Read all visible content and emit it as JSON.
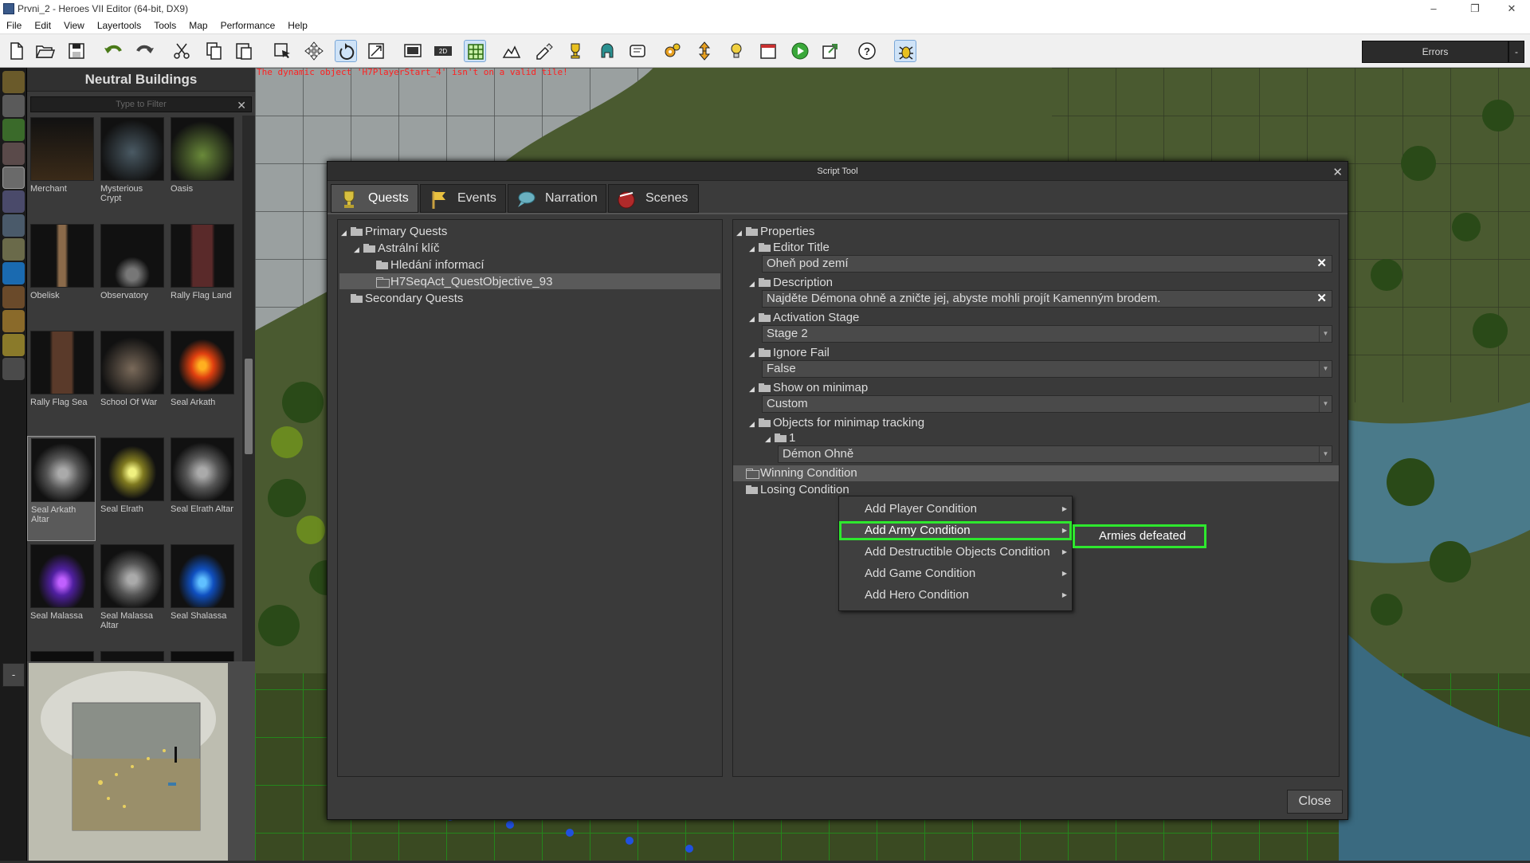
{
  "window": {
    "title": "Prvni_2 - Heroes VII Editor (64-bit, DX9)",
    "controls": [
      "–",
      "❐",
      "✕"
    ]
  },
  "menu": [
    "File",
    "Edit",
    "View",
    "Layertools",
    "Tools",
    "Map",
    "Performance",
    "Help"
  ],
  "toolbar": {
    "icons": [
      "new-file-icon",
      "open-folder-icon",
      "save-icon",
      "undo-icon",
      "redo-icon",
      "cut-icon",
      "copy-icon",
      "paste-icon",
      "select-icon",
      "move-icon",
      "rotate-icon",
      "scale-icon",
      "viewport-icon",
      "2d-view-icon",
      "grid-icon",
      "terrain-icon",
      "paint-icon",
      "trophy-icon",
      "helmet-icon",
      "map-scroll-icon",
      "gears-icon",
      "arrows-icon",
      "lightbulb-icon",
      "calendar-icon",
      "play-icon",
      "export-icon",
      "help-icon",
      "bug-icon"
    ],
    "errors_label": "Errors"
  },
  "left_panel": {
    "title": "Neutral Buildings",
    "filter_placeholder": "Type to Filter",
    "items": [
      {
        "label": "Merchant"
      },
      {
        "label": "Mysterious Crypt"
      },
      {
        "label": "Oasis"
      },
      {
        "label": "Obelisk"
      },
      {
        "label": "Observatory"
      },
      {
        "label": "Rally Flag Land"
      },
      {
        "label": "Rally Flag Sea"
      },
      {
        "label": "School Of War"
      },
      {
        "label": "Seal Arkath"
      },
      {
        "label": "Seal Arkath Altar",
        "selected": true
      },
      {
        "label": "Seal Elrath"
      },
      {
        "label": "Seal Elrath Altar"
      },
      {
        "label": "Seal Malassa"
      },
      {
        "label": "Seal Malassa Altar"
      },
      {
        "label": "Seal Shalassa"
      }
    ]
  },
  "minimap": {
    "collapse_label": "-"
  },
  "viewport": {
    "warning": "The dynamic object 'H7PlayerStart_4' isn't on a valid tile!"
  },
  "dialog": {
    "title": "Script Tool",
    "tabs": [
      {
        "label": "Quests",
        "active": true
      },
      {
        "label": "Events"
      },
      {
        "label": "Narration"
      },
      {
        "label": "Scenes"
      }
    ],
    "tree": {
      "primary": "Primary Quests",
      "quest": "Astrální klíč",
      "objective1": "Hledání informací",
      "objective2": "H7SeqAct_QuestObjective_93",
      "secondary": "Secondary Quests"
    },
    "properties": {
      "root": "Properties",
      "editor_title_label": "Editor Title",
      "editor_title_value": "Oheň pod zemí",
      "description_label": "Description",
      "description_value": "Najděte Démona ohně a zničte jej, abyste mohli projít Kamenným brodem.",
      "activation_stage_label": "Activation Stage",
      "activation_stage_value": "Stage 2",
      "ignore_fail_label": "Ignore Fail",
      "ignore_fail_value": "False",
      "show_minimap_label": "Show on minimap",
      "show_minimap_value": "Custom",
      "objects_tracking_label": "Objects for minimap tracking",
      "objects_tracking_index": "1",
      "objects_tracking_value": "Démon Ohně",
      "winning_label": "Winning Condition",
      "losing_label": "Losing Condition"
    },
    "close_label": "Close"
  },
  "context_menu": {
    "items": [
      {
        "label": "Add Player Condition"
      },
      {
        "label": "Add Army Condition",
        "active": true
      },
      {
        "label": "Add Destructible Objects Condition"
      },
      {
        "label": "Add Game Condition"
      },
      {
        "label": "Add Hero Condition"
      }
    ],
    "submenu": {
      "label": "Armies defeated"
    }
  },
  "colors": {
    "highlight_green": "#2ee82e",
    "warning_red": "#ff2020"
  }
}
